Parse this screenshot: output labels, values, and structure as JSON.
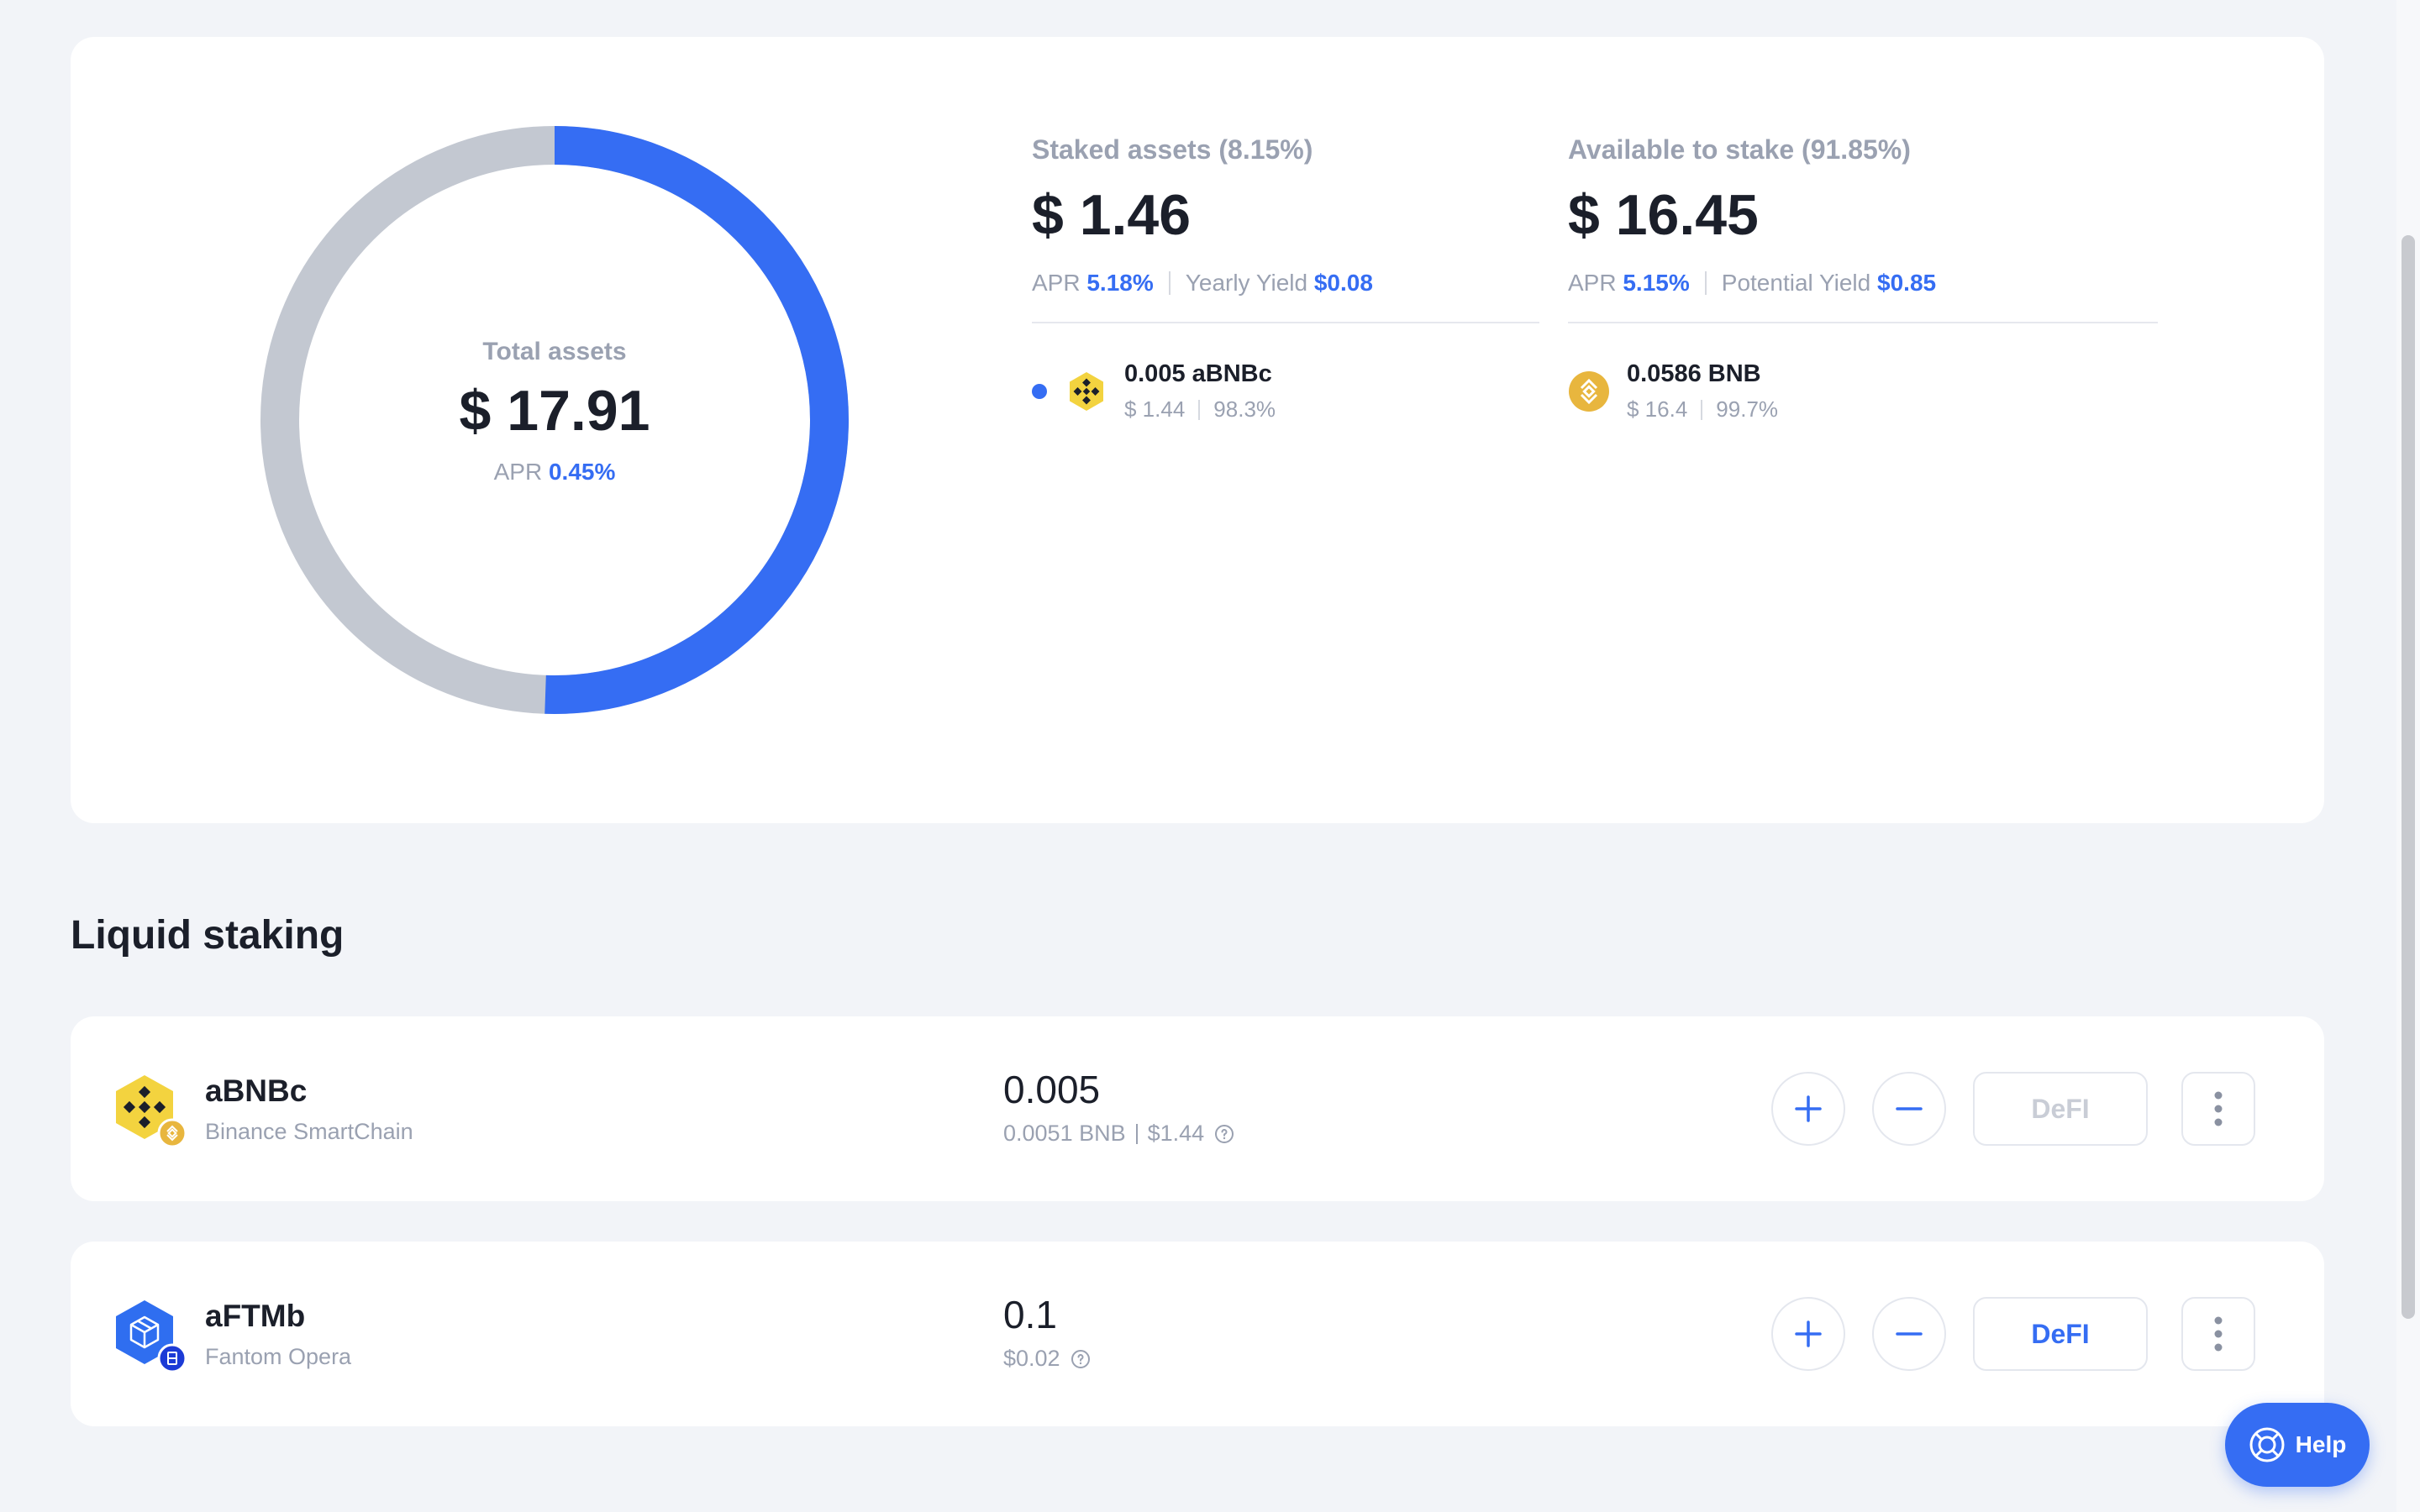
{
  "summary": {
    "total_label": "Total assets",
    "total_value": "$ 17.91",
    "apr_label": "APR",
    "apr_value": "0.45%",
    "staked_fraction": 0.0815,
    "staked": {
      "title": "Staked assets (8.15%)",
      "value": "$ 1.46",
      "apr_label": "APR",
      "apr_value": "5.18%",
      "yield_label": "Yearly Yield",
      "yield_value": "$0.08",
      "asset": {
        "amount": "0.005 aBNBc",
        "usd": "$ 1.44",
        "share": "98.3%",
        "icon": "abnbc-icon"
      }
    },
    "available": {
      "title": "Available to stake (91.85%)",
      "value": "$ 16.45",
      "apr_label": "APR",
      "apr_value": "5.15%",
      "yield_label": "Potential Yield",
      "yield_value": "$0.85",
      "asset": {
        "amount": "0.0586 BNB",
        "usd": "$ 16.4",
        "share": "99.7%",
        "icon": "bnb-icon"
      }
    }
  },
  "section_title": "Liquid staking",
  "tokens": [
    {
      "name": "aBNBc",
      "chain": "Binance SmartChain",
      "amount": "0.005",
      "sub_native": "0.0051 BNB",
      "sub_usd": "$1.44",
      "defi_label": "DeFI",
      "defi_enabled": false,
      "icon": "abnbc-icon"
    },
    {
      "name": "aFTMb",
      "chain": "Fantom Opera",
      "amount": "0.1",
      "sub_usd": "$0.02",
      "defi_label": "DeFI",
      "defi_enabled": true,
      "icon": "aftmb-icon"
    }
  ],
  "help_label": "Help",
  "colors": {
    "accent": "#356df3",
    "donut_rest": "#c3c8d1",
    "bnb_yellow": "#f3d33f",
    "bnb_gold": "#e8b63e",
    "ftm_blue": "#2f6ef0"
  }
}
